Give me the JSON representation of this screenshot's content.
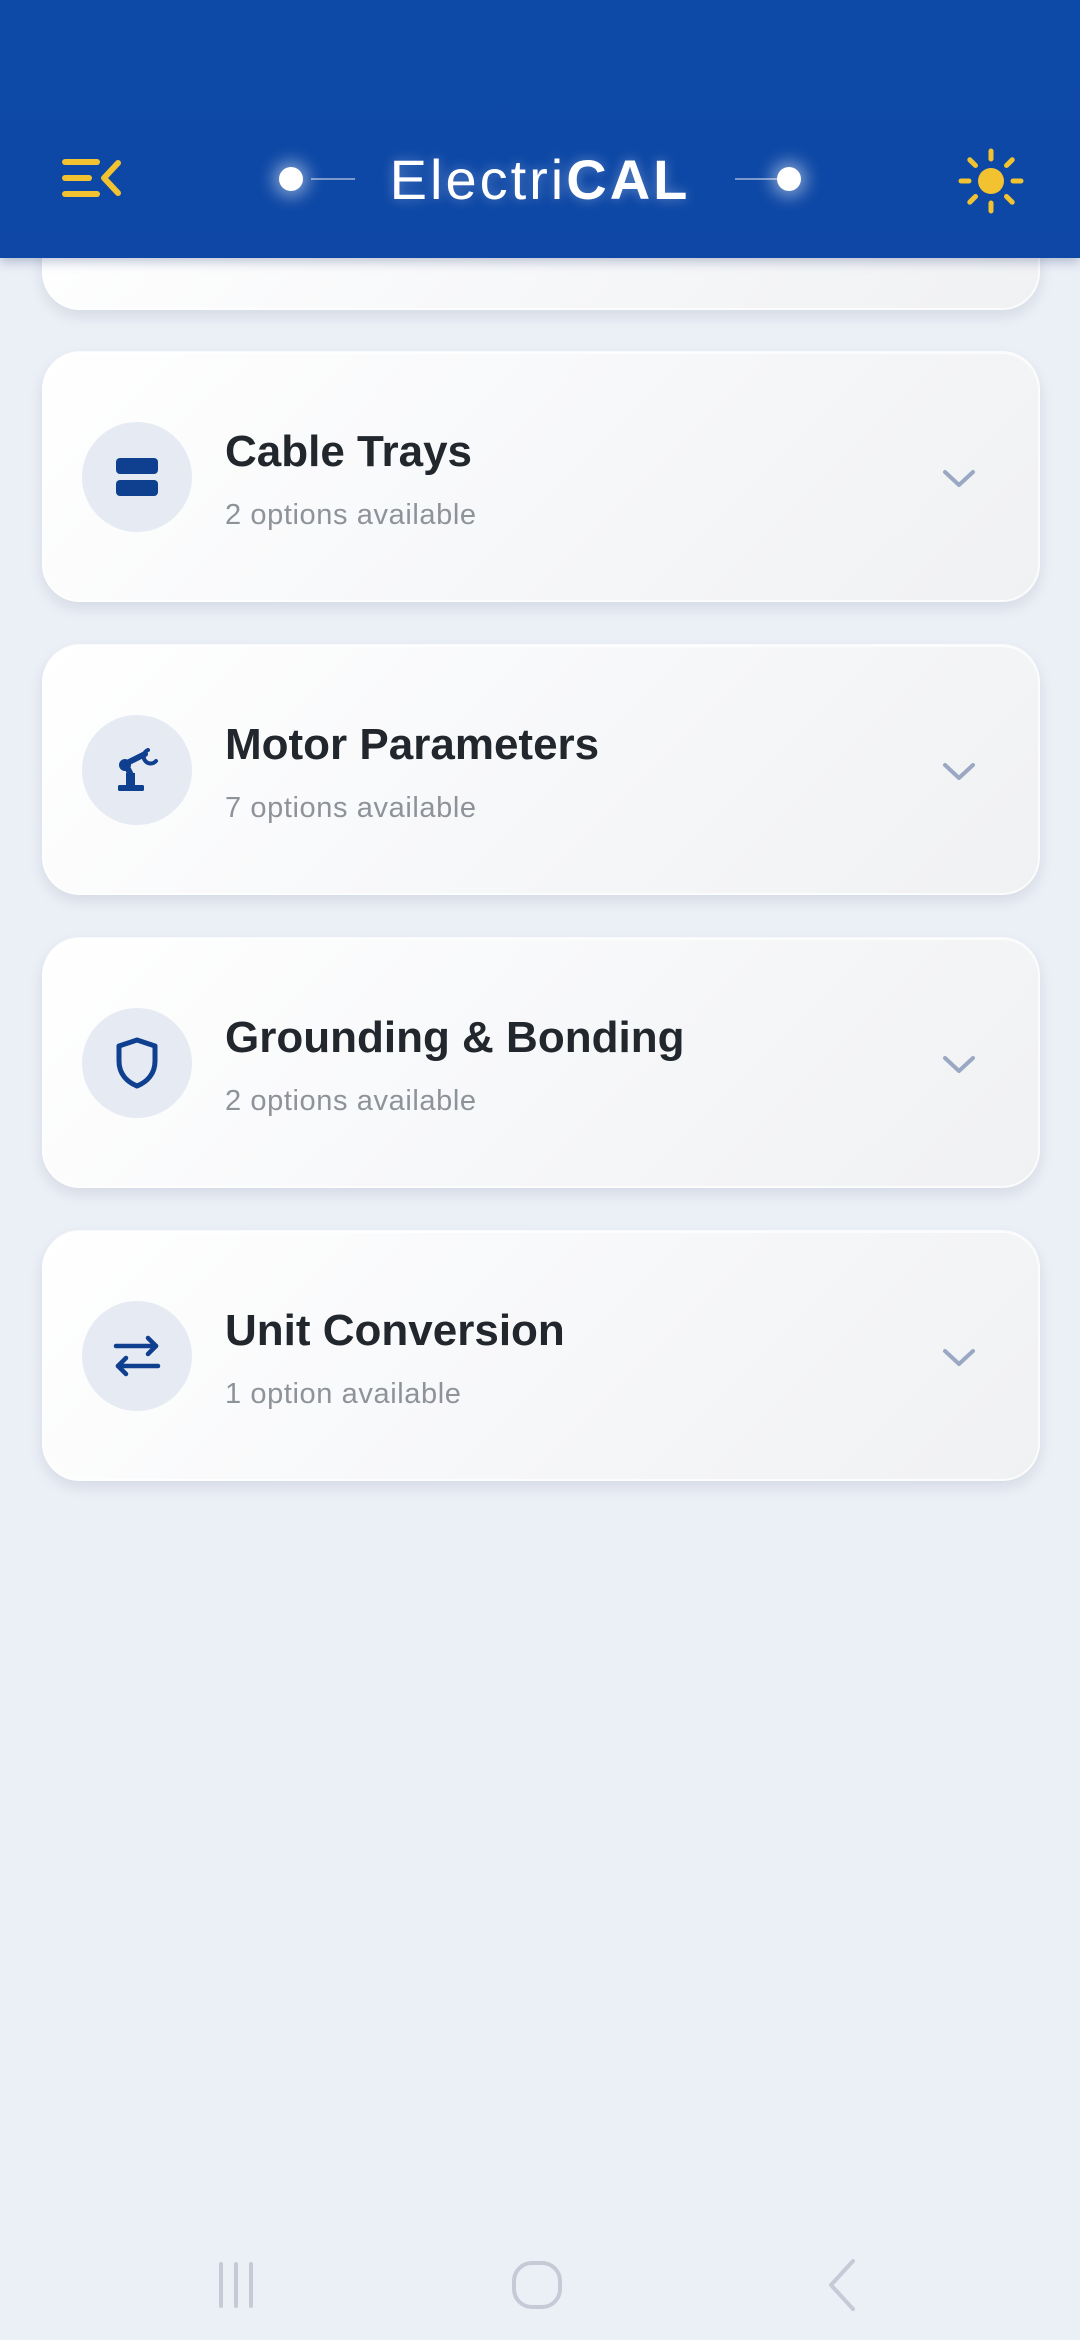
{
  "header": {
    "title_light": "Electri",
    "title_bold": "CAL",
    "menu_icon": "menu-collapse-icon",
    "theme_icon": "sun-icon"
  },
  "colors": {
    "header_bg": "#0d4aa8",
    "accent_yellow": "#f2c230",
    "icon_blue": "#0f3f8f",
    "page_bg": "#ebeff6"
  },
  "categories": [
    {
      "title": "Cable Trays",
      "subtitle": "2 options available",
      "icon": "cable-tray-icon"
    },
    {
      "title": "Motor Parameters",
      "subtitle": "7 options available",
      "icon": "robot-arm-icon"
    },
    {
      "title": "Grounding & Bonding",
      "subtitle": "2 options available",
      "icon": "shield-icon"
    },
    {
      "title": "Unit Conversion",
      "subtitle": "1 option available",
      "icon": "swap-arrows-icon"
    }
  ],
  "nav_bar": {
    "recents_icon": "recents-icon",
    "home_icon": "home-icon",
    "back_icon": "back-icon"
  }
}
